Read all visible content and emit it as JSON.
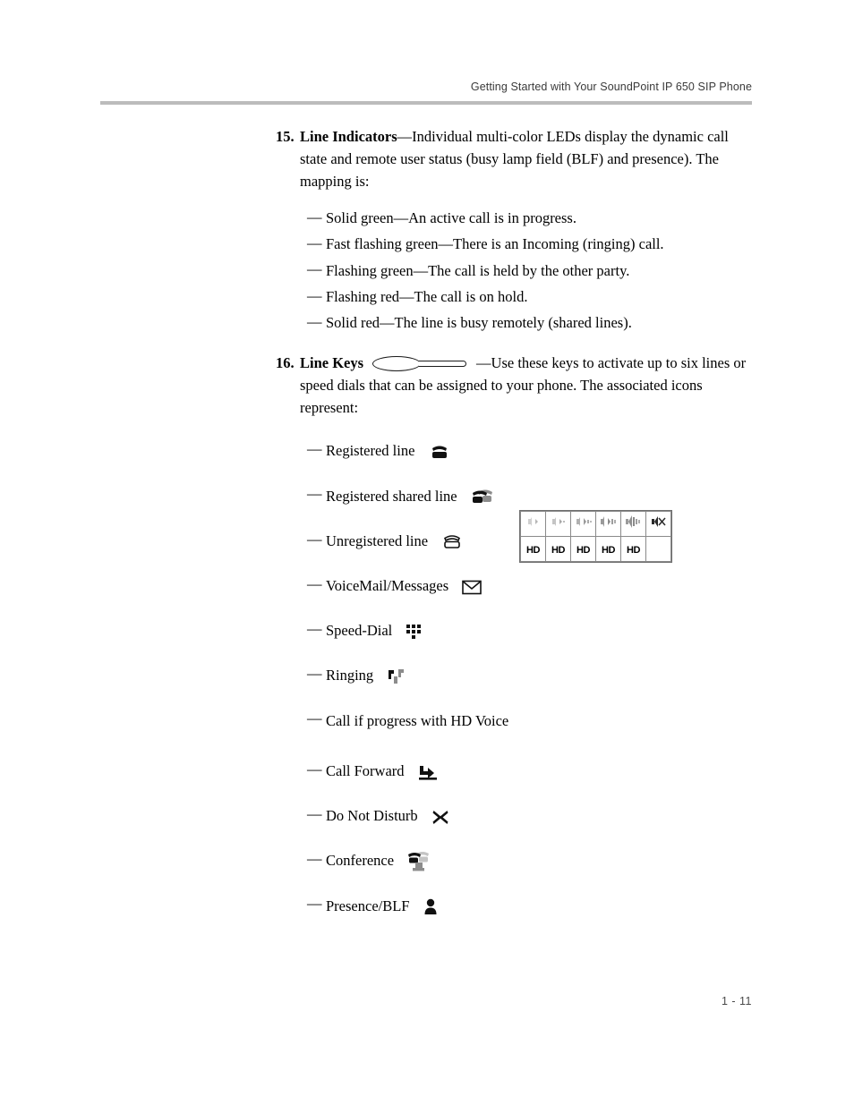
{
  "header": {
    "title": "Getting Started with Your SoundPoint IP 650 SIP Phone"
  },
  "items": [
    {
      "number": "15.",
      "term": "Line Indicators",
      "separator": "—",
      "description": "Individual multi-color LEDs display the dynamic call state and remote user status (busy lamp field (BLF) and presence). The mapping is:",
      "bullets": [
        "Solid green—An active call is in progress.",
        "Fast flashing green—There is an Incoming (ringing) call.",
        "Flashing green—The call is held by the other party.",
        "Flashing red—The call is on hold.",
        "Solid red—The line is busy remotely (shared lines)."
      ]
    },
    {
      "number": "16.",
      "term": "Line Keys",
      "separator": "—",
      "description": "Use these keys to activate up to six lines or speed dials that can be assigned to your phone. The associated icons represent:",
      "callout_shape": "ellipse-with-tail",
      "icon_bullets": [
        {
          "label": "Registered line",
          "icon": "phone-solid-icon"
        },
        {
          "label": "Registered shared line",
          "icon": "phone-shared-icon"
        },
        {
          "label": "Unregistered line",
          "icon": "phone-outline-icon"
        },
        {
          "label": "VoiceMail/Messages",
          "icon": "envelope-icon"
        },
        {
          "label": "Speed-Dial",
          "icon": "keypad-dots-icon"
        },
        {
          "label": "Ringing",
          "icon": "ringing-notes-icon"
        },
        {
          "label": "Call if progress with HD Voice",
          "icon": "hd-voice-animation-table"
        },
        {
          "label": "Call Forward",
          "icon": "call-forward-arrow-icon"
        },
        {
          "label": "Do Not Disturb",
          "icon": "x-mark-icon"
        },
        {
          "label": "Conference",
          "icon": "conference-phones-icon"
        },
        {
          "label": "Presence/BLF",
          "icon": "person-silhouette-icon"
        }
      ]
    }
  ],
  "hd_voice_table": {
    "columns": 6,
    "rows": 2,
    "top_row_icons": [
      "speaker-wave-1-icon",
      "speaker-wave-2-icon",
      "speaker-wave-3-icon",
      "speaker-wave-4-icon",
      "speaker-wave-5-icon",
      "speaker-muted-icon"
    ],
    "bottom_row_labels": [
      "HD",
      "HD",
      "HD",
      "HD",
      "HD",
      ""
    ]
  },
  "footer": {
    "page_number": "1 - 11"
  },
  "colors": {
    "rule": "#bcbcbc",
    "header_text": "#3a3a3a",
    "body_text": "#000000",
    "table_border": "#8a8a8a",
    "icon_dark": "#111111",
    "icon_gray": "#8c8c8c"
  }
}
